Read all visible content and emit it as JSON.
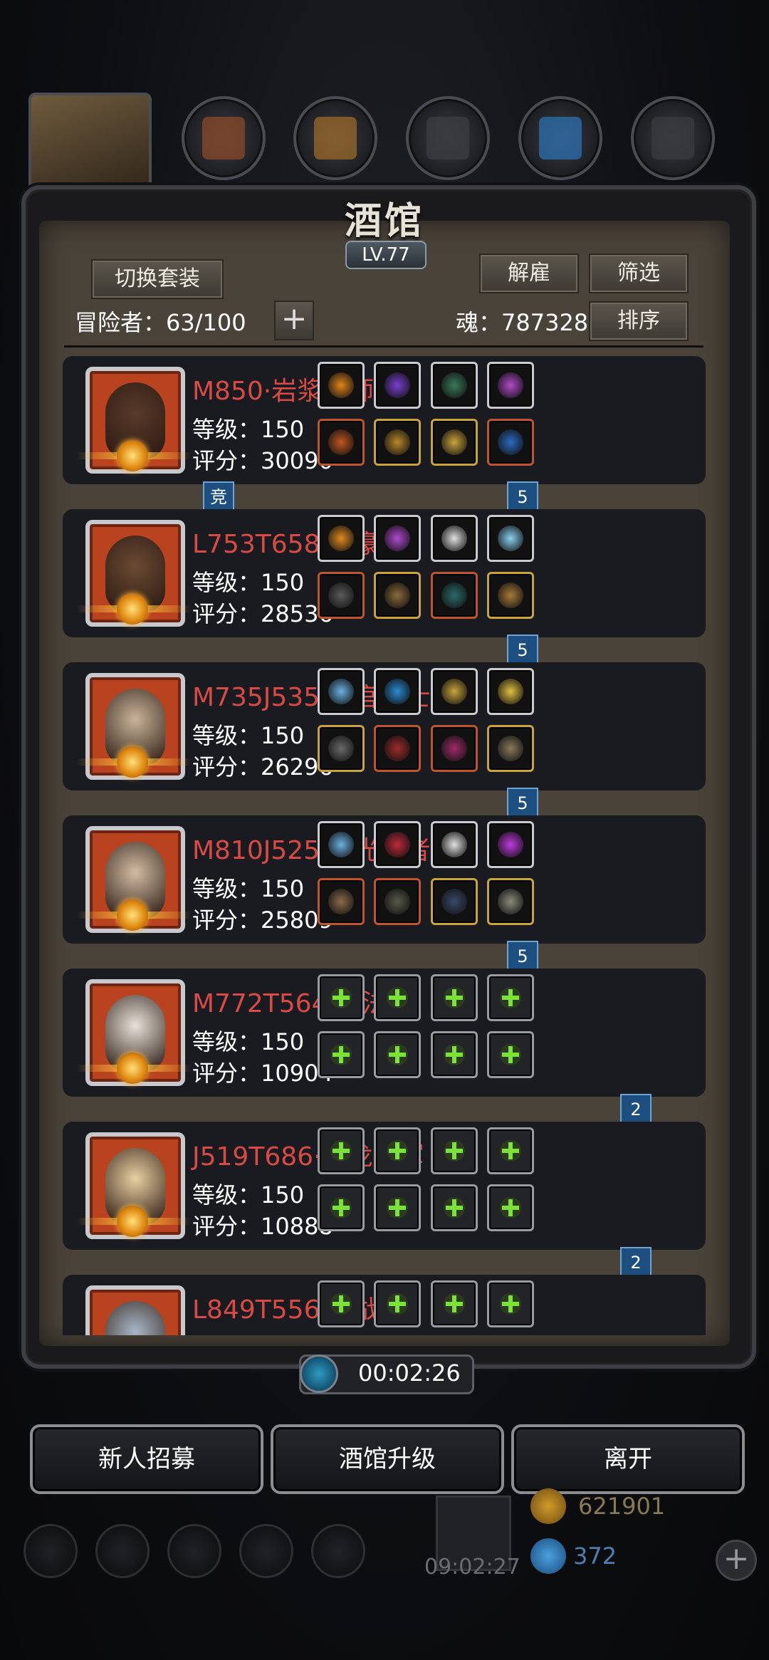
{
  "header": {
    "title": "酒馆",
    "level": "LV.77"
  },
  "toolbar": {
    "switch_outfit": "切换套装",
    "dismiss": "解雇",
    "filter": "筛选",
    "sort": "排序",
    "adventurers_label": "冒险者：63/100",
    "soul_label": "魂：787328"
  },
  "adventurers": [
    {
      "name": "M850·岩浆法师",
      "level": "等级：150",
      "score": "评分：30090",
      "badge": "竞",
      "rank": "5",
      "skin": "#5a3a2a"
    },
    {
      "name": "L753T658·剑豪",
      "level": "等级：150",
      "score": "评分：28536",
      "badge": "",
      "rank": "5",
      "skin": "#6b4a33"
    },
    {
      "name": "M735J535·神官骑士",
      "level": "等级：150",
      "score": "评分：26296",
      "badge": "",
      "rank": "5",
      "skin": "#c9b49a"
    },
    {
      "name": "M810J525·圣光贤者",
      "level": "等级：150",
      "score": "评分：25809",
      "badge": "",
      "rank": "5",
      "skin": "#d2bca3"
    },
    {
      "name": "M772T564·血法师",
      "level": "等级：150",
      "score": "评分：10904",
      "badge": "",
      "rank": "2",
      "skin": "#e8e2da"
    },
    {
      "name": "J519T686·圣龙将军",
      "level": "等级：150",
      "score": "评分：10888",
      "badge": "",
      "rank": "2",
      "skin": "#e9cfa2"
    },
    {
      "name": "L849T556·狂战神",
      "level": "",
      "score": "",
      "badge": "",
      "rank": "",
      "skin": "#aab7c6"
    }
  ],
  "timer": "00:02:26",
  "actions": {
    "recruit": "新人招募",
    "upgrade": "酒馆升级",
    "leave": "离开"
  },
  "resources": {
    "gold": "621901",
    "gems": "372",
    "bottom_time": "09:02:27"
  },
  "colors": {
    "name_red": "#d94a44",
    "panel": "#4a4339",
    "ribbon_blue": "#1c4f7f",
    "plus_green": "#7be23a"
  }
}
